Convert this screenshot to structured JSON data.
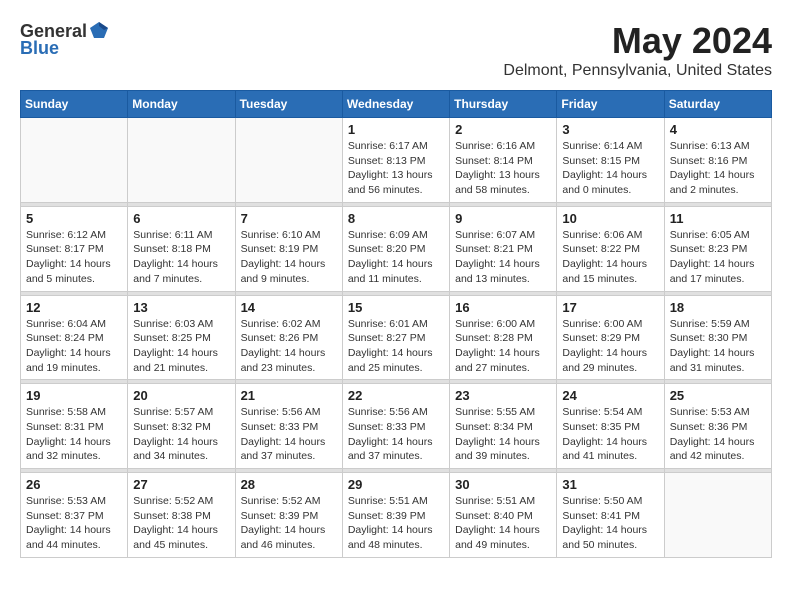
{
  "header": {
    "logo_general": "General",
    "logo_blue": "Blue",
    "month_year": "May 2024",
    "location": "Delmont, Pennsylvania, United States"
  },
  "weekdays": [
    "Sunday",
    "Monday",
    "Tuesday",
    "Wednesday",
    "Thursday",
    "Friday",
    "Saturday"
  ],
  "weeks": [
    [
      {
        "day": "",
        "info": ""
      },
      {
        "day": "",
        "info": ""
      },
      {
        "day": "",
        "info": ""
      },
      {
        "day": "1",
        "info": "Sunrise: 6:17 AM\nSunset: 8:13 PM\nDaylight: 13 hours\nand 56 minutes."
      },
      {
        "day": "2",
        "info": "Sunrise: 6:16 AM\nSunset: 8:14 PM\nDaylight: 13 hours\nand 58 minutes."
      },
      {
        "day": "3",
        "info": "Sunrise: 6:14 AM\nSunset: 8:15 PM\nDaylight: 14 hours\nand 0 minutes."
      },
      {
        "day": "4",
        "info": "Sunrise: 6:13 AM\nSunset: 8:16 PM\nDaylight: 14 hours\nand 2 minutes."
      }
    ],
    [
      {
        "day": "5",
        "info": "Sunrise: 6:12 AM\nSunset: 8:17 PM\nDaylight: 14 hours\nand 5 minutes."
      },
      {
        "day": "6",
        "info": "Sunrise: 6:11 AM\nSunset: 8:18 PM\nDaylight: 14 hours\nand 7 minutes."
      },
      {
        "day": "7",
        "info": "Sunrise: 6:10 AM\nSunset: 8:19 PM\nDaylight: 14 hours\nand 9 minutes."
      },
      {
        "day": "8",
        "info": "Sunrise: 6:09 AM\nSunset: 8:20 PM\nDaylight: 14 hours\nand 11 minutes."
      },
      {
        "day": "9",
        "info": "Sunrise: 6:07 AM\nSunset: 8:21 PM\nDaylight: 14 hours\nand 13 minutes."
      },
      {
        "day": "10",
        "info": "Sunrise: 6:06 AM\nSunset: 8:22 PM\nDaylight: 14 hours\nand 15 minutes."
      },
      {
        "day": "11",
        "info": "Sunrise: 6:05 AM\nSunset: 8:23 PM\nDaylight: 14 hours\nand 17 minutes."
      }
    ],
    [
      {
        "day": "12",
        "info": "Sunrise: 6:04 AM\nSunset: 8:24 PM\nDaylight: 14 hours\nand 19 minutes."
      },
      {
        "day": "13",
        "info": "Sunrise: 6:03 AM\nSunset: 8:25 PM\nDaylight: 14 hours\nand 21 minutes."
      },
      {
        "day": "14",
        "info": "Sunrise: 6:02 AM\nSunset: 8:26 PM\nDaylight: 14 hours\nand 23 minutes."
      },
      {
        "day": "15",
        "info": "Sunrise: 6:01 AM\nSunset: 8:27 PM\nDaylight: 14 hours\nand 25 minutes."
      },
      {
        "day": "16",
        "info": "Sunrise: 6:00 AM\nSunset: 8:28 PM\nDaylight: 14 hours\nand 27 minutes."
      },
      {
        "day": "17",
        "info": "Sunrise: 6:00 AM\nSunset: 8:29 PM\nDaylight: 14 hours\nand 29 minutes."
      },
      {
        "day": "18",
        "info": "Sunrise: 5:59 AM\nSunset: 8:30 PM\nDaylight: 14 hours\nand 31 minutes."
      }
    ],
    [
      {
        "day": "19",
        "info": "Sunrise: 5:58 AM\nSunset: 8:31 PM\nDaylight: 14 hours\nand 32 minutes."
      },
      {
        "day": "20",
        "info": "Sunrise: 5:57 AM\nSunset: 8:32 PM\nDaylight: 14 hours\nand 34 minutes."
      },
      {
        "day": "21",
        "info": "Sunrise: 5:56 AM\nSunset: 8:33 PM\nDaylight: 14 hours\nand 37 minutes."
      },
      {
        "day": "22",
        "info": "Sunrise: 5:56 AM\nSunset: 8:33 PM\nDaylight: 14 hours\nand 37 minutes."
      },
      {
        "day": "23",
        "info": "Sunrise: 5:55 AM\nSunset: 8:34 PM\nDaylight: 14 hours\nand 39 minutes."
      },
      {
        "day": "24",
        "info": "Sunrise: 5:54 AM\nSunset: 8:35 PM\nDaylight: 14 hours\nand 41 minutes."
      },
      {
        "day": "25",
        "info": "Sunrise: 5:53 AM\nSunset: 8:36 PM\nDaylight: 14 hours\nand 42 minutes."
      }
    ],
    [
      {
        "day": "26",
        "info": "Sunrise: 5:53 AM\nSunset: 8:37 PM\nDaylight: 14 hours\nand 44 minutes."
      },
      {
        "day": "27",
        "info": "Sunrise: 5:52 AM\nSunset: 8:38 PM\nDaylight: 14 hours\nand 45 minutes."
      },
      {
        "day": "28",
        "info": "Sunrise: 5:52 AM\nSunset: 8:39 PM\nDaylight: 14 hours\nand 46 minutes."
      },
      {
        "day": "29",
        "info": "Sunrise: 5:51 AM\nSunset: 8:39 PM\nDaylight: 14 hours\nand 48 minutes."
      },
      {
        "day": "30",
        "info": "Sunrise: 5:51 AM\nSunset: 8:40 PM\nDaylight: 14 hours\nand 49 minutes."
      },
      {
        "day": "31",
        "info": "Sunrise: 5:50 AM\nSunset: 8:41 PM\nDaylight: 14 hours\nand 50 minutes."
      },
      {
        "day": "",
        "info": ""
      }
    ]
  ]
}
